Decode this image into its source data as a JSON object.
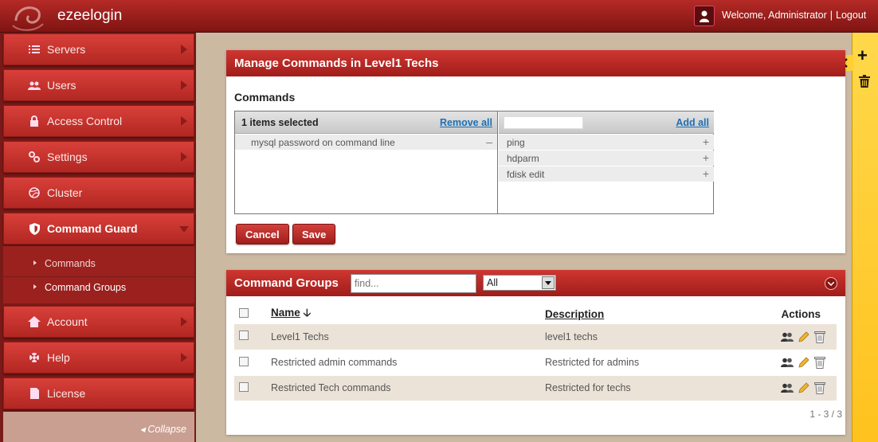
{
  "app": {
    "name": "ezeelogin"
  },
  "header": {
    "welcome": "Welcome, Administrator",
    "separator": "|",
    "logout": "Logout"
  },
  "sidebar": {
    "items": [
      {
        "label": "Servers",
        "icon": "list-icon"
      },
      {
        "label": "Users",
        "icon": "users-icon"
      },
      {
        "label": "Access Control",
        "icon": "lock-icon"
      },
      {
        "label": "Settings",
        "icon": "gears-icon"
      },
      {
        "label": "Cluster",
        "icon": "dribbble-icon"
      },
      {
        "label": "Command Guard",
        "icon": "shield-icon"
      },
      {
        "label": "Account",
        "icon": "home-icon"
      },
      {
        "label": "Help",
        "icon": "lifebuoy-icon"
      },
      {
        "label": "License",
        "icon": "document-icon"
      }
    ],
    "subitems": [
      {
        "label": "Commands"
      },
      {
        "label": "Command Groups"
      }
    ],
    "collapse": "◂ Collapse"
  },
  "manage": {
    "title": "Manage Commands in Level1 Techs",
    "section_label": "Commands",
    "selected": {
      "count_label": "1 items selected",
      "remove_all": "Remove all",
      "items": [
        "mysql password on command line"
      ]
    },
    "available": {
      "add_all": "Add all",
      "items": [
        "ping",
        "hdparm",
        "fdisk edit"
      ]
    },
    "cancel": "Cancel",
    "save": "Save"
  },
  "groups": {
    "title": "Command Groups",
    "find_placeholder": "find...",
    "filter_value": "All",
    "columns": {
      "name": "Name",
      "description": "Description",
      "actions": "Actions"
    },
    "rows": [
      {
        "name": "Level1 Techs",
        "description": "level1 techs"
      },
      {
        "name": "Restricted admin commands",
        "description": "Restricted for admins"
      },
      {
        "name": "Restricted Tech commands",
        "description": "Restricted for techs"
      }
    ],
    "pager": "1 - 3 / 3"
  },
  "colors": {
    "brand_red": "#b52a26",
    "accent_yellow": "#ffc21e",
    "link_blue": "#1f6fb5"
  }
}
